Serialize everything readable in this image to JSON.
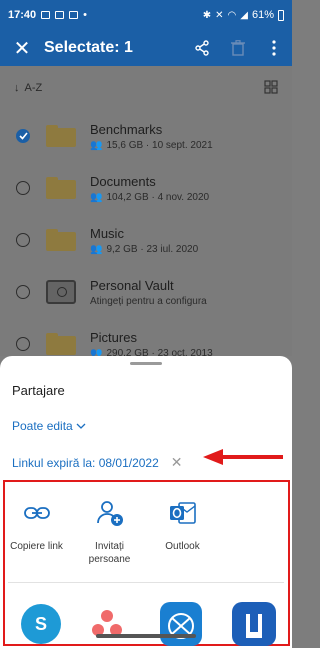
{
  "status_bar": {
    "time": "17:40",
    "battery": "61%",
    "bullet": "•"
  },
  "app_bar": {
    "title": "Selectate: 1",
    "close_glyph": "✕"
  },
  "sort": {
    "label": "A-Z",
    "arrow": "↓"
  },
  "files": [
    {
      "name": "Benchmarks",
      "meta": "15,6 GB · 10 sept. 2021",
      "selected": true,
      "kind": "folder"
    },
    {
      "name": "Documents",
      "meta": "104,2 GB · 4 nov. 2020",
      "selected": false,
      "kind": "folder"
    },
    {
      "name": "Music",
      "meta": "9,2 GB · 23 iul. 2020",
      "selected": false,
      "kind": "folder"
    },
    {
      "name": "Personal Vault",
      "meta": "Atingeți pentru a configura",
      "selected": false,
      "kind": "vault"
    },
    {
      "name": "Pictures",
      "meta": "290,2 GB · 23 oct. 2013",
      "selected": false,
      "kind": "folder"
    }
  ],
  "sheet": {
    "title": "Partajare",
    "permission": "Poate edita",
    "expiry": "Linkul expiră la: 08/01/2022",
    "expiry_clear": "✕",
    "options": [
      {
        "label": "Copiere link",
        "icon": "link-icon"
      },
      {
        "label": "Invitați persoane",
        "icon": "invite-person-icon"
      },
      {
        "label": "Outlook",
        "icon": "outlook-icon"
      }
    ],
    "apps": [
      {
        "icon": "skype-icon",
        "color": "#1e9ad6"
      },
      {
        "icon": "asana-icon",
        "color": "#f06a6a"
      },
      {
        "icon": "app-icon",
        "color": "#1a7fd1"
      },
      {
        "icon": "app-icon-2",
        "color": "#1d5fb8"
      }
    ]
  },
  "colors": {
    "accent": "#1b5fa6",
    "link": "#1b6fc1",
    "highlight": "#e11a1a"
  }
}
